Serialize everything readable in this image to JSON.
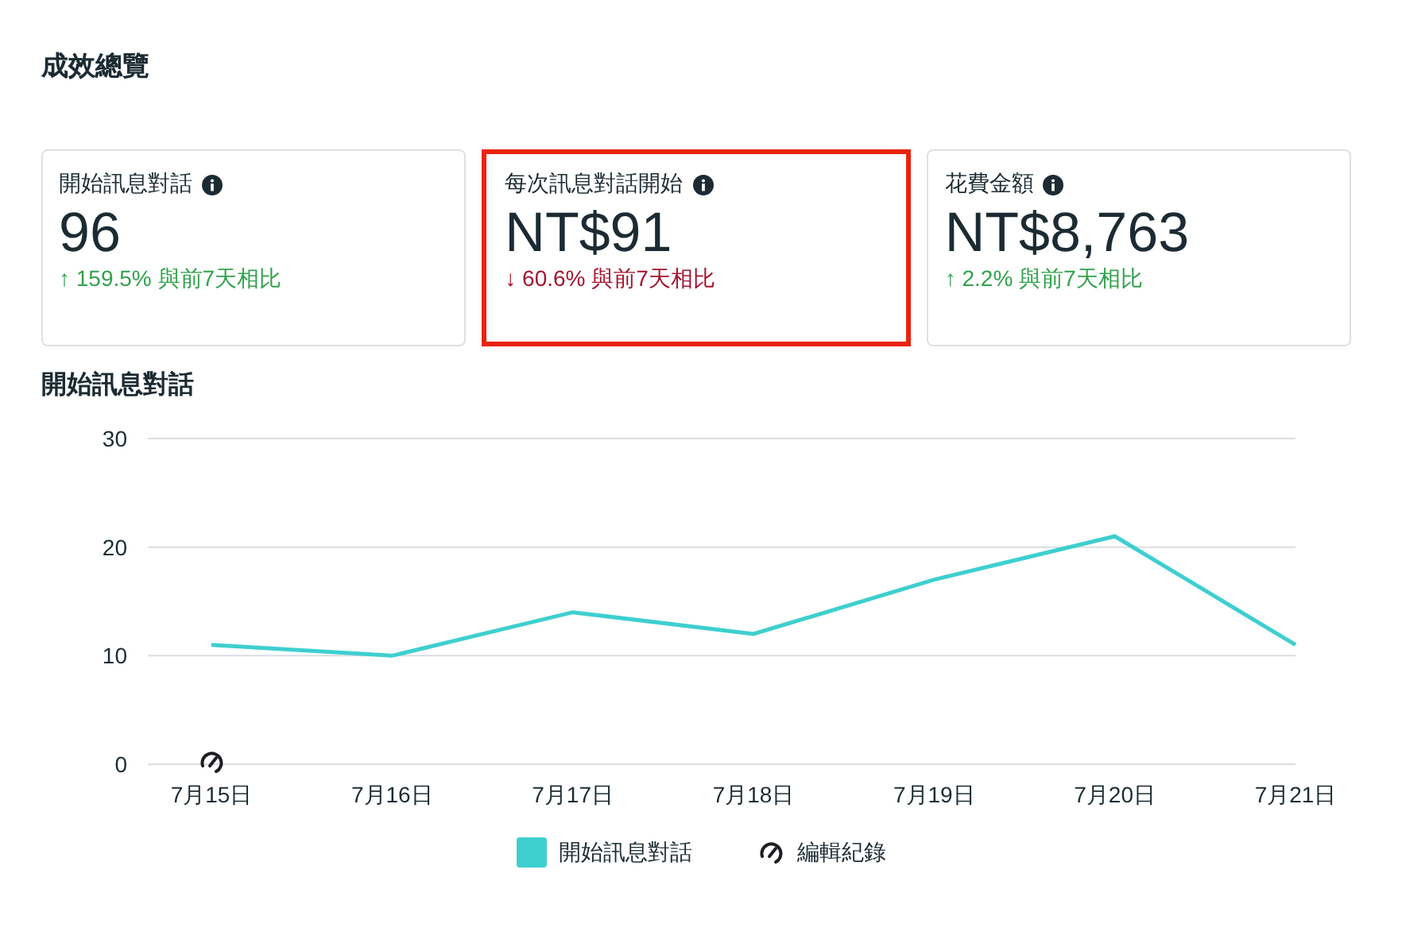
{
  "title": "成效總覽",
  "cards": [
    {
      "label": "開始訊息對話",
      "value": "96",
      "trend": "↑ 159.5% 與前7天相比",
      "kind": "up",
      "highlighted": false
    },
    {
      "label": "每次訊息對話開始",
      "value": "NT$91",
      "trend": "↓ 60.6% 與前7天相比",
      "kind": "down",
      "highlighted": true
    },
    {
      "label": "花費金額",
      "value": "NT$8,763",
      "trend": "↑ 2.2% 與前7天相比",
      "kind": "up",
      "highlighted": false
    }
  ],
  "chart_title": "開始訊息對話",
  "chart_data": {
    "type": "line",
    "categories": [
      "7月15日",
      "7月16日",
      "7月17日",
      "7月18日",
      "7月19日",
      "7月20日",
      "7月21日"
    ],
    "series": [
      {
        "name": "開始訊息對話",
        "color": "#3ecfcf",
        "values": [
          11,
          10,
          14,
          12,
          17,
          21,
          11
        ]
      }
    ],
    "ylim": [
      0,
      30
    ],
    "yticks": [
      0,
      10,
      20,
      30
    ],
    "annotations": [
      {
        "x": "7月15日"
      }
    ]
  },
  "edit_log_legend": {
    "label": "編輯紀錄"
  }
}
